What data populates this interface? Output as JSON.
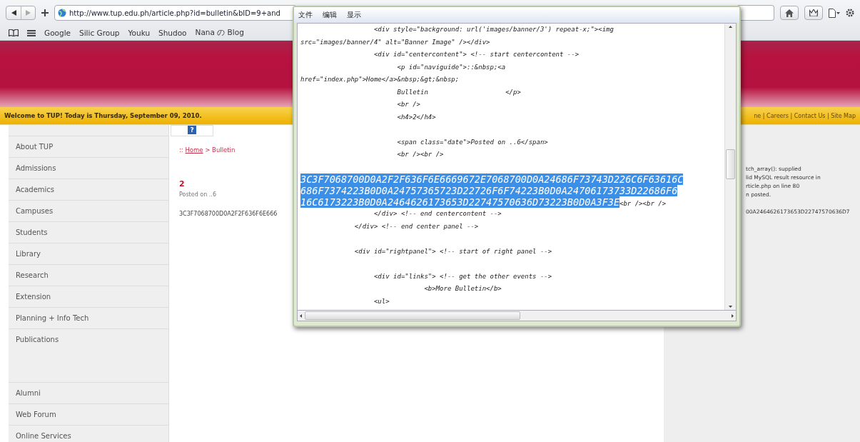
{
  "toolbar": {
    "url": "http://www.tup.edu.ph/article.php?id=bulletin&bID=9+and"
  },
  "bookmarks": [
    "Google",
    "Silic Group",
    "Youku",
    "Shudoo",
    "Nana の Blog"
  ],
  "site": {
    "welcome": "Welcome to TUP! Today is Thursday, September 09, 2010.",
    "top_links": "ne | Careers | Contact Us | Site Map",
    "menu_groups": [
      [
        "About TUP",
        "Admissions",
        "Academics",
        "Campuses",
        "Students",
        "Library",
        "Research",
        "Extension",
        "Planning + Info Tech",
        "Publications"
      ],
      [
        "Alumni",
        "Web Forum",
        "Online Services"
      ]
    ],
    "breadcrumb": {
      "prefix": ":: ",
      "link": "Home",
      "suffix": " > Bulletin"
    },
    "image_glyph": "?",
    "article_title": "2",
    "posted": "Posted on ..6",
    "body": "3C3F7068700D0A2F2F636F6E666",
    "right_panel": [
      "tch_array(): supplied",
      "lid MySQL result resource in",
      "rticle.php on line 80",
      "n posted.",
      "00A2464626173653D22747570636D7"
    ]
  },
  "source_window": {
    "menu": [
      "文件",
      "编辑",
      "显示"
    ],
    "lines": [
      {
        "kind": "code",
        "text": "                   <div style=\"background: url('images/banner/3') repeat-x;\"><img"
      },
      {
        "kind": "code",
        "text": "src=\"images/banner/4\" alt=\"Banner Image\" /></div>"
      },
      {
        "kind": "code",
        "text": "                   <div id=\"centercontent\"> <!-- start centercontent -->"
      },
      {
        "kind": "code",
        "text": "                         <p id=\"naviguide\">::&nbsp;<a"
      },
      {
        "kind": "code",
        "text": "href=\"index.php\">Home</a>&nbsp;&gt;&nbsp;"
      },
      {
        "kind": "code",
        "text": "                         Bulletin                    </p>"
      },
      {
        "kind": "code",
        "text": "                         <br />"
      },
      {
        "kind": "code",
        "text": "                         <h4>2</h4>"
      },
      {
        "kind": "blank"
      },
      {
        "kind": "code",
        "text": "                         <span class=\"date\">Posted on ..6</span>"
      },
      {
        "kind": "code",
        "text": "                         <br /><br />"
      },
      {
        "kind": "blank"
      },
      {
        "kind": "selected",
        "text": "3C3F7068700D0A2F2F636F6E6669672E7068700D0A24686F73743D226C6F63616C"
      },
      {
        "kind": "selected",
        "text": "686F7374223B0D0A24757365723D22726F6F74223B0D0A24706173733D22686F6"
      },
      {
        "kind": "selected",
        "text": "16C6173223B0D0A2464626173653D22747570636D73223B0D0A3F3E",
        "after": "<br /><br />"
      },
      {
        "kind": "code",
        "text": "                   </div> <!-- end centercontent -->"
      },
      {
        "kind": "code",
        "text": "              </div> <!-- end center panel -->"
      },
      {
        "kind": "blank"
      },
      {
        "kind": "code",
        "text": "              <div id=\"rightpanel\"> <!-- start of right panel -->"
      },
      {
        "kind": "blank"
      },
      {
        "kind": "code",
        "text": "                   <div id=\"links\"> <!-- get the other events -->"
      },
      {
        "kind": "code",
        "text": "                                <b>More Bulletin</b>"
      },
      {
        "kind": "code",
        "text": "                   <ul>"
      }
    ]
  }
}
